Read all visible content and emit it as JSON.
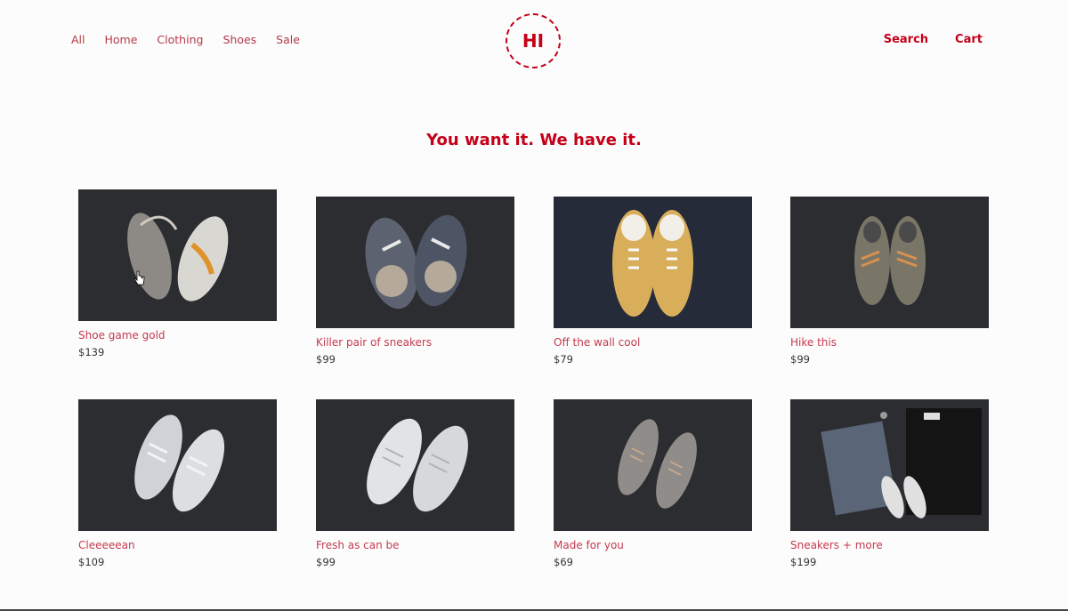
{
  "header": {
    "nav_left": [
      {
        "label": "All"
      },
      {
        "label": "Home"
      },
      {
        "label": "Clothing"
      },
      {
        "label": "Shoes"
      },
      {
        "label": "Sale"
      }
    ],
    "logo_text": "HI",
    "nav_right": [
      {
        "label": "Search"
      },
      {
        "label": "Cart"
      }
    ]
  },
  "hero": {
    "title": "You want it. We have it."
  },
  "products": [
    {
      "name": "Shoe game gold",
      "price": "$139"
    },
    {
      "name": "Killer pair of sneakers",
      "price": "$99"
    },
    {
      "name": "Off the wall cool",
      "price": "$79"
    },
    {
      "name": "Hike this",
      "price": "$99"
    },
    {
      "name": "Cleeeeean",
      "price": "$109"
    },
    {
      "name": "Fresh as can be",
      "price": "$99"
    },
    {
      "name": "Made for you",
      "price": "$69"
    },
    {
      "name": "Sneakers + more",
      "price": "$199"
    }
  ],
  "colors": {
    "accent": "#c4001a",
    "link": "#c43a4e",
    "image_bg": "#2c2d30"
  }
}
